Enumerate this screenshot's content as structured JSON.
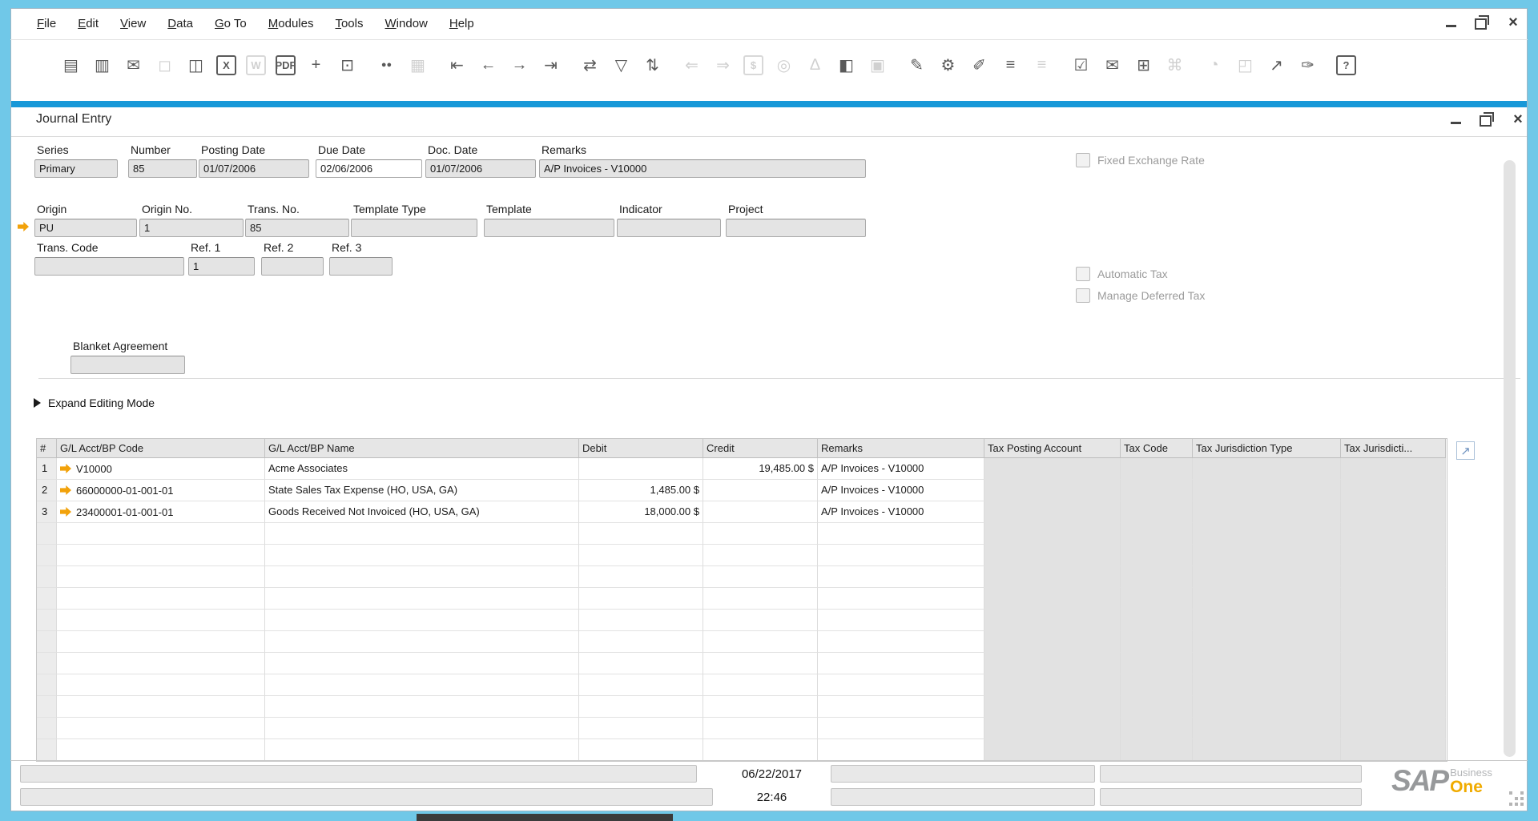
{
  "colors": {
    "frame-cyan": "#70c8e8",
    "accent-blue": "#1898d8",
    "link-orange": "#f2a20a",
    "sap-orange": "#f0ab00"
  },
  "menu": {
    "items": [
      "File",
      "Edit",
      "View",
      "Data",
      "Go To",
      "Modules",
      "Tools",
      "Window",
      "Help"
    ]
  },
  "toolbar": {
    "groups": [
      [
        {
          "name": "preview-document-icon",
          "glyph": "▤",
          "enabled": true
        },
        {
          "name": "print-icon",
          "glyph": "▥",
          "enabled": true
        },
        {
          "name": "email-icon",
          "glyph": "✉",
          "enabled": true
        },
        {
          "name": "sms-icon",
          "glyph": "◻",
          "enabled": false
        },
        {
          "name": "copy-special-icon",
          "glyph": "◫",
          "enabled": true
        },
        {
          "name": "export-excel-icon",
          "glyph": "X",
          "enabled": true,
          "boxed": true
        },
        {
          "name": "export-word-icon",
          "glyph": "W",
          "enabled": false,
          "boxed": true
        },
        {
          "name": "export-pdf-icon",
          "glyph": "PDF",
          "enabled": true,
          "boxed": true,
          "small": true
        },
        {
          "name": "move-icon",
          "glyph": "+",
          "enabled": true
        },
        {
          "name": "lock-screen-icon",
          "glyph": "⊡",
          "enabled": true
        }
      ],
      [
        {
          "name": "find-icon",
          "glyph": "●●",
          "enabled": true,
          "small": true
        },
        {
          "name": "add-record-icon",
          "glyph": "▦",
          "enabled": false
        }
      ],
      [
        {
          "name": "first-record-icon",
          "glyph": "⇤",
          "enabled": true
        },
        {
          "name": "previous-record-icon",
          "glyph": "←",
          "enabled": true
        },
        {
          "name": "next-record-icon",
          "glyph": "→",
          "enabled": true
        },
        {
          "name": "last-record-icon",
          "glyph": "⇥",
          "enabled": true
        }
      ],
      [
        {
          "name": "refresh-icon",
          "glyph": "⇄",
          "enabled": true
        },
        {
          "name": "filter-icon",
          "glyph": "▽",
          "enabled": true
        },
        {
          "name": "sort-icon",
          "glyph": "⇅",
          "enabled": true
        }
      ],
      [
        {
          "name": "copy-from-icon",
          "glyph": "⇐",
          "enabled": false
        },
        {
          "name": "copy-to-icon",
          "glyph": "⇒",
          "enabled": false
        },
        {
          "name": "payment-means-icon",
          "glyph": "$",
          "enabled": false,
          "boxed": true
        },
        {
          "name": "coins-icon",
          "glyph": "◎",
          "enabled": false
        },
        {
          "name": "reconcile-icon",
          "glyph": "∆",
          "enabled": false
        },
        {
          "name": "split-view-icon",
          "glyph": "◧",
          "enabled": true
        },
        {
          "name": "document-lookup-icon",
          "glyph": "▣",
          "enabled": false
        }
      ],
      [
        {
          "name": "edit-icon",
          "glyph": "✎",
          "enabled": true
        },
        {
          "name": "form-settings-icon",
          "glyph": "⚙",
          "enabled": true
        },
        {
          "name": "document-settings-icon",
          "glyph": "✐",
          "enabled": true
        },
        {
          "name": "chat-icon",
          "glyph": "≡",
          "enabled": true
        },
        {
          "name": "chat-quote-icon",
          "glyph": "≡",
          "enabled": false
        }
      ],
      [
        {
          "name": "checklist-icon",
          "glyph": "☑",
          "enabled": true
        },
        {
          "name": "mail-alert-icon",
          "glyph": "✉",
          "enabled": true
        },
        {
          "name": "calendar-icon",
          "glyph": "⊞",
          "enabled": true
        },
        {
          "name": "org-chart-icon",
          "glyph": "⌘",
          "enabled": false
        }
      ],
      [
        {
          "name": "gauge-icon",
          "glyph": "◔",
          "enabled": false
        },
        {
          "name": "layout-designer-icon",
          "glyph": "◰",
          "enabled": false
        },
        {
          "name": "analysis-icon",
          "glyph": "↗",
          "enabled": true
        },
        {
          "name": "chart-edit-icon",
          "glyph": "✑",
          "enabled": true
        }
      ],
      [
        {
          "name": "help-icon",
          "glyph": "?",
          "enabled": true,
          "boxed": true
        }
      ]
    ]
  },
  "child_window": {
    "title": "Journal Entry"
  },
  "form": {
    "series": {
      "label": "Series",
      "value": "Primary"
    },
    "number": {
      "label": "Number",
      "value": "85"
    },
    "posting_date": {
      "label": "Posting Date",
      "value": "01/07/2006"
    },
    "due_date": {
      "label": "Due Date",
      "value": "02/06/2006"
    },
    "doc_date": {
      "label": "Doc. Date",
      "value": "01/07/2006"
    },
    "remarks": {
      "label": "Remarks",
      "value": "A/P Invoices - V10000"
    },
    "origin": {
      "label": "Origin",
      "value": "PU"
    },
    "origin_no": {
      "label": "Origin No.",
      "value": "1"
    },
    "trans_no": {
      "label": "Trans. No.",
      "value": "85"
    },
    "template_type": {
      "label": "Template Type",
      "value": ""
    },
    "template": {
      "label": "Template",
      "value": ""
    },
    "indicator": {
      "label": "Indicator",
      "value": ""
    },
    "project": {
      "label": "Project",
      "value": ""
    },
    "trans_code": {
      "label": "Trans. Code",
      "value": ""
    },
    "ref1": {
      "label": "Ref. 1",
      "value": "1"
    },
    "ref2": {
      "label": "Ref. 2",
      "value": ""
    },
    "ref3": {
      "label": "Ref. 3",
      "value": ""
    },
    "blanket_agreement": {
      "label": "Blanket Agreement",
      "value": ""
    }
  },
  "checkboxes": {
    "fixed_exchange_rate": {
      "label": "Fixed Exchange Rate",
      "checked": false
    },
    "automatic_tax": {
      "label": "Automatic Tax",
      "checked": false
    },
    "manage_deferred_tax": {
      "label": "Manage Deferred Tax",
      "checked": false
    }
  },
  "expand_editing_mode": "Expand Editing Mode",
  "table": {
    "columns": [
      "#",
      "G/L Acct/BP Code",
      "G/L Acct/BP Name",
      "Debit",
      "Credit",
      "Remarks",
      "Tax Posting Account",
      "Tax Code",
      "Tax Jurisdiction Type",
      "Tax Jurisdicti..."
    ],
    "rows": [
      {
        "num": "1",
        "code": "V10000",
        "name": "Acme Associates",
        "debit": "",
        "credit": "19,485.00 $",
        "remarks": "A/P Invoices - V10000"
      },
      {
        "num": "2",
        "code": "66000000-01-001-01",
        "name": "State Sales Tax Expense (HO, USA, GA)",
        "debit": "1,485.00 $",
        "credit": "",
        "remarks": "A/P Invoices - V10000"
      },
      {
        "num": "3",
        "code": "23400001-01-001-01",
        "name": "Goods Received Not Invoiced (HO, USA, GA)",
        "debit": "18,000.00 $",
        "credit": "",
        "remarks": "A/P Invoices - V10000"
      }
    ],
    "empty_row_count": 11
  },
  "status_bar": {
    "date": "06/22/2017",
    "time": "22:46"
  },
  "branding": {
    "sap": "SAP",
    "business": "Business",
    "one": "One"
  }
}
